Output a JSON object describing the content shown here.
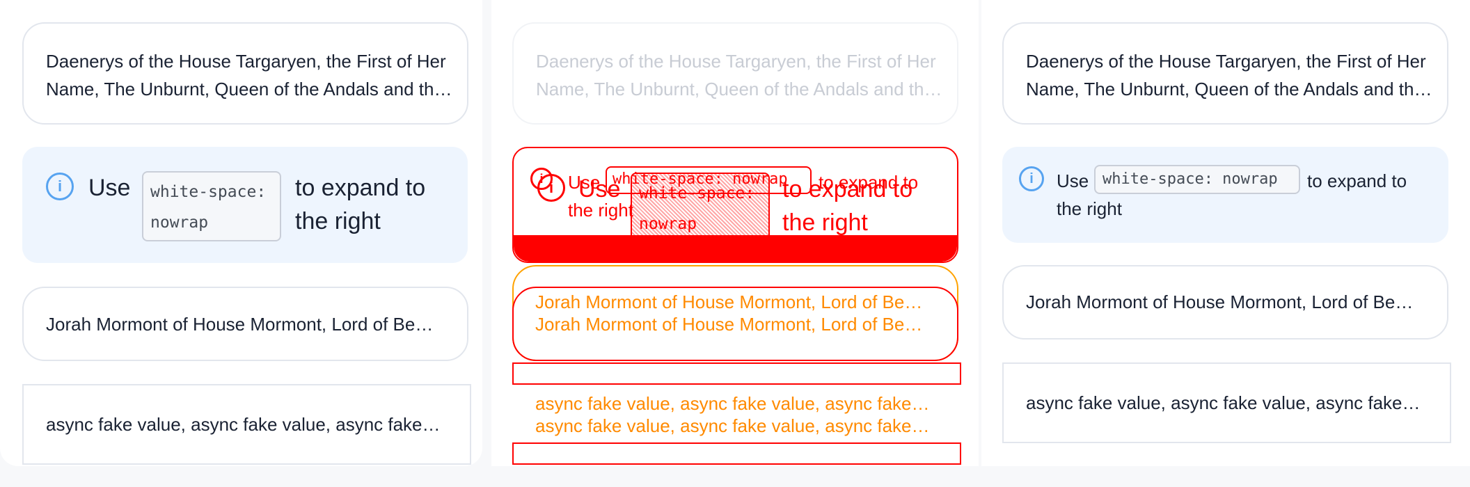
{
  "items": {
    "daenerys": "Daenerys of the House Targaryen, the First of Her Name, The Unburnt, Queen of the Andals and the First Men",
    "alert_use": "Use",
    "alert_code": "white-space: nowrap",
    "alert_code_line1": "white-space:",
    "alert_code_line2": "nowrap",
    "alert_rest": "to expand to the right",
    "alert_rest_line1": "to expand to",
    "alert_rest_line2": "the right",
    "jorah": "Jorah Mormont of House Mormont, Lord of Bear Island",
    "async": "async fake value, async fake value, async fake value, async fake value"
  },
  "icons": {
    "info": "info-circle-icon"
  },
  "colors": {
    "card_border": "#e2e6ed",
    "alert_bg": "#eef5fe",
    "info_icon": "#57a3f0",
    "overlay_red": "#ff0000",
    "overlay_orange": "#ff8a00"
  }
}
